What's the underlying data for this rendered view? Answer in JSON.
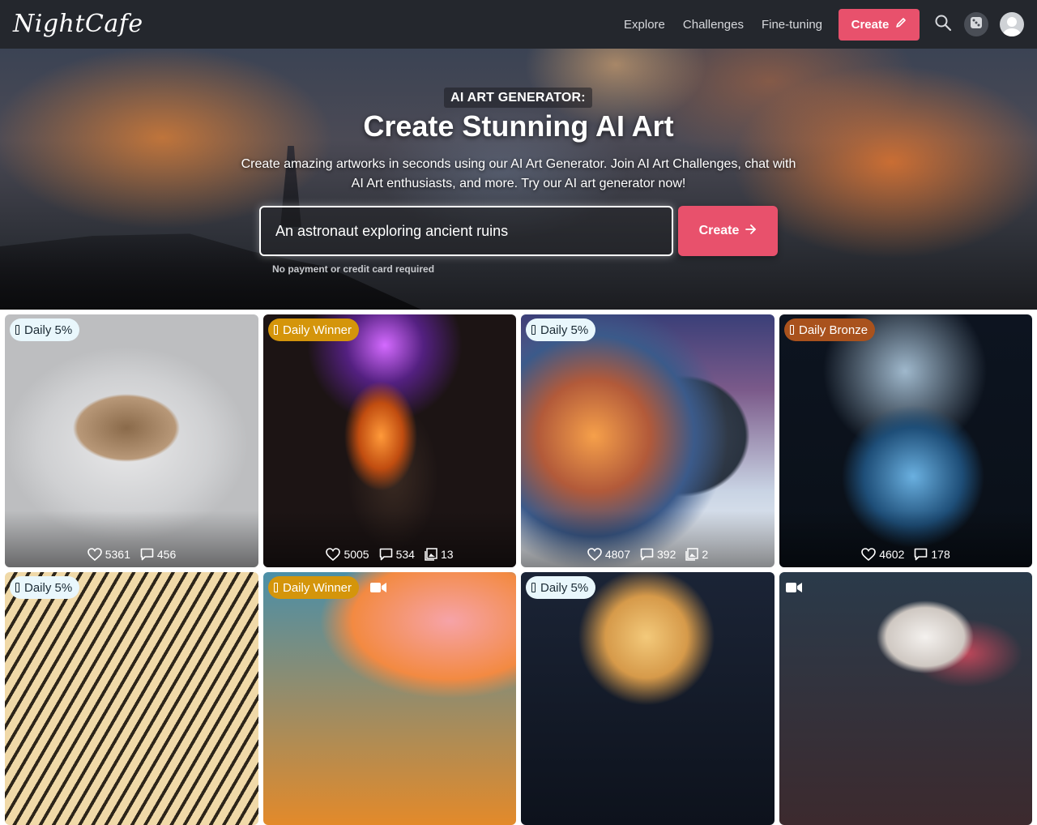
{
  "nav": {
    "logo": "NightCafe",
    "links": [
      "Explore",
      "Challenges",
      "Fine-tuning"
    ],
    "create_label": "Create"
  },
  "hero": {
    "badge": "AI ART GENERATOR:",
    "title": "Create Stunning AI Art",
    "subtitle": "Create amazing artworks in seconds using our AI Art Generator. Join AI Art Challenges, chat with AI Art enthusiasts, and more. Try our AI art generator now!",
    "prompt_value": "An astronaut exploring ancient ruins",
    "create_label": "Create",
    "note": "No payment or credit card required"
  },
  "cards": [
    {
      "badge": "Daily 5%",
      "badge_type": "5",
      "likes": "5361",
      "comments": "456",
      "images": null,
      "video": false
    },
    {
      "badge": "Daily Winner",
      "badge_type": "winner",
      "likes": "5005",
      "comments": "534",
      "images": "13",
      "video": false
    },
    {
      "badge": "Daily 5%",
      "badge_type": "5",
      "likes": "4807",
      "comments": "392",
      "images": "2",
      "video": false
    },
    {
      "badge": "Daily Bronze",
      "badge_type": "bronze",
      "likes": "4602",
      "comments": "178",
      "images": null,
      "video": false
    },
    {
      "badge": "Daily 5%",
      "badge_type": "5",
      "video": false
    },
    {
      "badge": "Daily Winner",
      "badge_type": "winner",
      "video": true
    },
    {
      "badge": "Daily 5%",
      "badge_type": "5",
      "video": false
    },
    {
      "badge": null,
      "badge_type": null,
      "video": true
    }
  ],
  "colors": {
    "navbar": "#24272d",
    "accent": "#e8516c",
    "badge_5": "#e9f7fc",
    "badge_winner": "#d4950b",
    "badge_bronze": "#a9521d"
  },
  "icons": [
    "pencil-icon",
    "search-icon",
    "dice-icon",
    "user-icon",
    "arrow-right-icon",
    "trophy-icon",
    "heart-icon",
    "comment-icon",
    "images-icon",
    "video-icon"
  ]
}
